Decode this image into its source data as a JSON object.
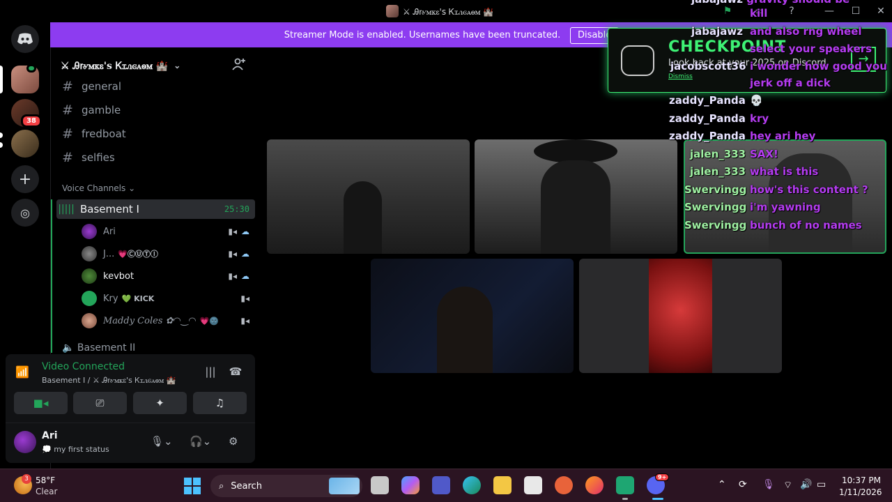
{
  "window": {
    "title": "⚔ Ꭿꭇꮍꮇꮶꮛ's Ꮶꮖꮑꮆꭺꮻꮇ 🏰",
    "minimize": "—",
    "maximize": "☐",
    "close": "✕",
    "inbox_icon": "inbox-icon",
    "help": "?"
  },
  "servers": [
    {
      "name": "home"
    },
    {
      "name": "server-1"
    },
    {
      "name": "server-2",
      "badge": "38"
    },
    {
      "name": "server-3"
    }
  ],
  "banner": {
    "text": "Streamer Mode is enabled. Usernames have been truncated.",
    "disable_label": "Disable"
  },
  "sidebar": {
    "server_name": "⚔ Ꭿꭇꮍꮇꮶꮛ's Ꮶꮖꮑꮆꭺꮻꮇ 🏰",
    "text_channels": [
      "general",
      "gamble",
      "fredboat",
      "selfies"
    ],
    "voice_header": "Voice Channels",
    "active_voice": {
      "name": "Basement I",
      "timer": "25:30"
    },
    "members": [
      {
        "name": "Ari",
        "tag": ""
      },
      {
        "name": "J...",
        "tag": "💗ⒸⓊⓉⒾ"
      },
      {
        "name": "kevbot",
        "tag": ""
      },
      {
        "name": "Kry",
        "tag": "💚 KICK"
      },
      {
        "name": "𝑀𝑎𝑑𝑑𝑦 𝐶𝑜𝑙𝑒𝑠 ✿◠‿◠",
        "tag": "💗🌚"
      }
    ],
    "next_channel": "Basement II"
  },
  "voice_panel": {
    "status": "Video Connected",
    "location": "Basement I / ⚔ Ꭿꭇꮍꮇꮶꮛ's Ꮶꮖꮑꮆꭺꮻꮇ 🏰",
    "buttons": [
      "camera",
      "screenshare",
      "activities",
      "soundboard"
    ]
  },
  "user": {
    "name": "Ari",
    "status": "💭 my first status"
  },
  "checkpoint": {
    "title": "CHECKPOINT",
    "text": "Look back at your 2025 on Discord",
    "dismiss": "Dismiss"
  },
  "chat": [
    {
      "user": "jabajawz",
      "msg": "gravity should be"
    },
    {
      "user": "",
      "msg": "kill"
    },
    {
      "user": "jabajawz",
      "msg": "and also rng wheel"
    },
    {
      "user": "",
      "msg": "select your speakers"
    },
    {
      "user": "jacobscott36",
      "msg": "i wonder how good you"
    },
    {
      "user": "",
      "msg": "jerk off a dick"
    },
    {
      "user": "zaddy_Panda",
      "msg": "💀"
    },
    {
      "user": "zaddy_Panda",
      "msg": "kry"
    },
    {
      "user": "zaddy_Panda",
      "msg": "hey ari hey"
    },
    {
      "user": "jalen_333",
      "msg": "SAX!"
    },
    {
      "user": "jalen_333",
      "msg": "what is this"
    },
    {
      "user": "Swervingg",
      "msg": "how's this content ?"
    },
    {
      "user": "Swervingg",
      "msg": "i'm yawning"
    },
    {
      "user": "Swervingg",
      "msg": "bunch of no names"
    }
  ],
  "taskbar": {
    "weather_temp": "58°F",
    "weather_cond": "Clear",
    "weather_badge": "3",
    "search_label": "Search",
    "discord_badge": "9+",
    "time": "10:37 PM",
    "date": "1/11/2026"
  }
}
